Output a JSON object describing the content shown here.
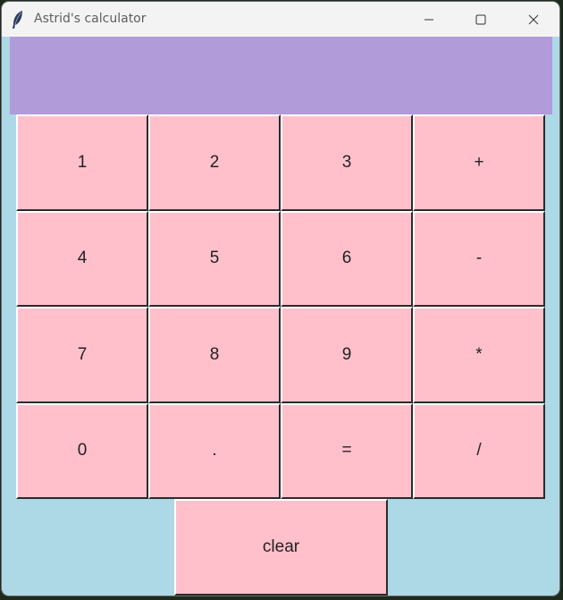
{
  "window": {
    "title": "Astrid's calculator"
  },
  "display": {
    "value": ""
  },
  "keypad": {
    "rows": [
      [
        "1",
        "2",
        "3",
        "+"
      ],
      [
        "4",
        "5",
        "6",
        "-"
      ],
      [
        "7",
        "8",
        "9",
        "*"
      ],
      [
        "0",
        ".",
        "=",
        "/"
      ]
    ],
    "clear_label": "clear"
  },
  "colors": {
    "background": "#add8e6",
    "display": "#b19cd9",
    "button": "#ffc0cb",
    "titlebar": "#f3f3f3"
  },
  "icons": {
    "app": "feather-icon",
    "minimize": "minimize-icon",
    "maximize": "maximize-icon",
    "close": "close-icon"
  }
}
